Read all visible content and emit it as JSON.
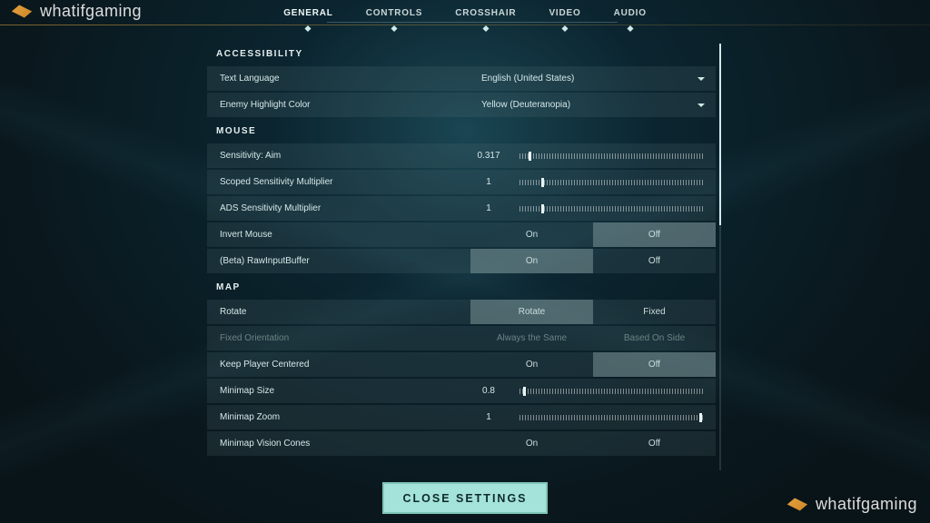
{
  "watermark": "whatifgaming",
  "tabs": [
    "GENERAL",
    "CONTROLS",
    "CROSSHAIR",
    "VIDEO",
    "AUDIO"
  ],
  "active_tab": 0,
  "sections": {
    "accessibility": {
      "title": "ACCESSIBILITY",
      "text_language": {
        "label": "Text Language",
        "value": "English (United States)"
      },
      "enemy_highlight": {
        "label": "Enemy Highlight Color",
        "value": "Yellow (Deuteranopia)"
      }
    },
    "mouse": {
      "title": "MOUSE",
      "sens_aim": {
        "label": "Sensitivity: Aim",
        "value": "0.317",
        "pct": 5
      },
      "scoped_mult": {
        "label": "Scoped Sensitivity Multiplier",
        "value": "1",
        "pct": 12
      },
      "ads_mult": {
        "label": "ADS Sensitivity Multiplier",
        "value": "1",
        "pct": 12
      },
      "invert": {
        "label": "Invert Mouse",
        "opts": [
          "On",
          "Off"
        ],
        "sel": 1
      },
      "rawinput": {
        "label": "(Beta) RawInputBuffer",
        "opts": [
          "On",
          "Off"
        ],
        "sel": 0
      }
    },
    "map": {
      "title": "MAP",
      "rotate": {
        "label": "Rotate",
        "opts": [
          "Rotate",
          "Fixed"
        ],
        "sel": 0
      },
      "fixed_orient": {
        "label": "Fixed Orientation",
        "opts": [
          "Always the Same",
          "Based On Side"
        ],
        "sel": -1
      },
      "keep_centered": {
        "label": "Keep Player Centered",
        "opts": [
          "On",
          "Off"
        ],
        "sel": 1
      },
      "mini_size": {
        "label": "Minimap Size",
        "value": "0.8",
        "pct": 2
      },
      "mini_zoom": {
        "label": "Minimap Zoom",
        "value": "1",
        "pct": 98
      },
      "mini_cones": {
        "label": "Minimap Vision Cones",
        "opts": [
          "On",
          "Off"
        ],
        "sel": -1
      }
    }
  },
  "close_label": "CLOSE SETTINGS"
}
